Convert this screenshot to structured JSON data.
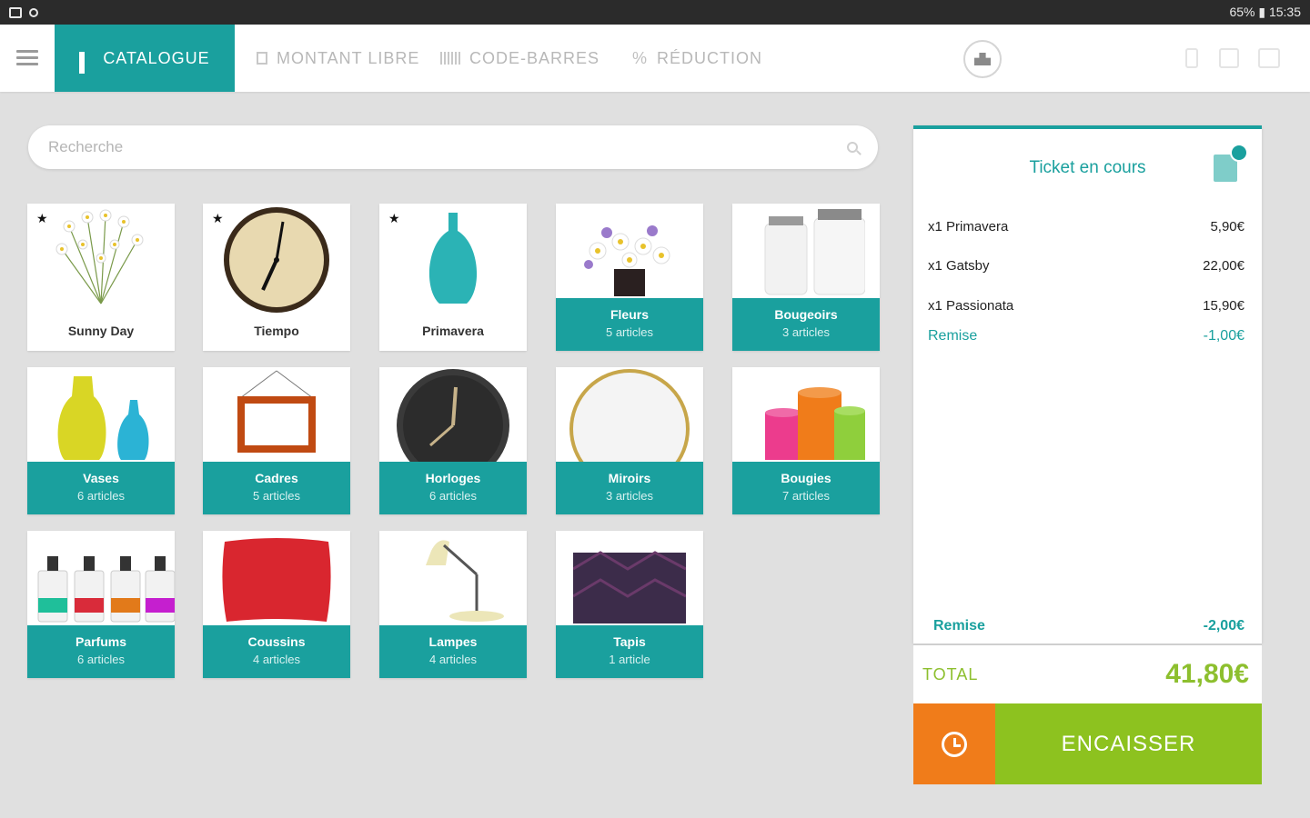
{
  "statusbar": {
    "right_text": "65% ▮ 15:35"
  },
  "tabs": [
    {
      "label": "CATALOGUE",
      "icon": "grid-icon"
    },
    {
      "label": "MONTANT LIBRE",
      "icon": "document-icon"
    },
    {
      "label": "CODE-BARRES",
      "icon": "barcode-icon"
    },
    {
      "label": "RÉDUCTION",
      "icon": "percent-icon",
      "glyph": "%"
    }
  ],
  "search": {
    "placeholder": "Recherche"
  },
  "products": [
    {
      "name": "Sunny Day",
      "favorite": "★"
    },
    {
      "name": "Tiempo",
      "favorite": "★"
    },
    {
      "name": "Primavera",
      "favorite": "★"
    }
  ],
  "categories": [
    {
      "name": "Fleurs",
      "count": "5 articles"
    },
    {
      "name": "Bougeoirs",
      "count": "3 articles"
    },
    {
      "name": "Vases",
      "count": "6 articles"
    },
    {
      "name": "Cadres",
      "count": "5 articles"
    },
    {
      "name": "Horloges",
      "count": "6 articles"
    },
    {
      "name": "Miroirs",
      "count": "3 articles"
    },
    {
      "name": "Bougies",
      "count": "7 articles"
    },
    {
      "name": "Parfums",
      "count": "6 articles"
    },
    {
      "name": "Coussins",
      "count": "4 articles"
    },
    {
      "name": "Lampes",
      "count": "4 articles"
    },
    {
      "name": "Tapis",
      "count": "1 article"
    }
  ],
  "ticket": {
    "title": "Ticket en cours",
    "lines": [
      {
        "label": "x1  Primavera",
        "price": "5,90€"
      },
      {
        "label": "x1  Gatsby",
        "price": "22,00€"
      },
      {
        "label": "x1  Passionata",
        "price": "15,90€"
      }
    ],
    "line_discount": {
      "label": "Remise",
      "amount": "-1,00€"
    },
    "global_discount": {
      "label": "Remise",
      "amount": "-2,00€"
    },
    "total_label": "TOTAL",
    "total_value": "41,80€",
    "pay_label": "ENCAISSER"
  },
  "colors": {
    "teal": "#1aa09e",
    "green": "#8dc21f",
    "orange": "#f07c1a"
  }
}
